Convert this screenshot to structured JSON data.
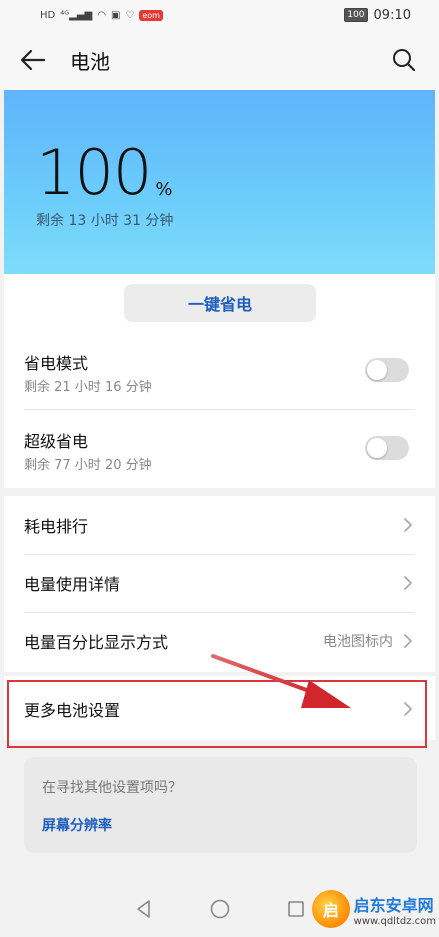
{
  "status_bar": {
    "left_icons": [
      "HD",
      "4G",
      "signal",
      "wifi",
      "app",
      "heart",
      "badge"
    ],
    "badge_text": "eom",
    "battery_text": "100",
    "time": "09:10"
  },
  "app_bar": {
    "title": "电池"
  },
  "hero": {
    "percent": "100",
    "unit": "%",
    "remaining": "剩余 13 小时 31 分钟"
  },
  "one_key": {
    "label": "一键省电"
  },
  "modes": [
    {
      "title": "省电模式",
      "sub": "剩余 21 小时 16 分钟",
      "on": false
    },
    {
      "title": "超级省电",
      "sub": "剩余 77 小时 20 分钟",
      "on": false
    }
  ],
  "nav_items": [
    {
      "label": "耗电排行",
      "value": ""
    },
    {
      "label": "电量使用详情",
      "value": ""
    },
    {
      "label": "电量百分比显示方式",
      "value": "电池图标内"
    }
  ],
  "more": {
    "label": "更多电池设置"
  },
  "tip": {
    "question": "在寻找其他设置项吗？",
    "link": "屏幕分辨率"
  },
  "watermark": {
    "logo": "启",
    "name": "启东安卓网",
    "url": "www.qdltdz.com"
  },
  "colors": {
    "accent": "#1f5fbf",
    "highlight": "#d9363e",
    "hero_top": "#5fb4fb",
    "hero_bottom": "#7fdcfa"
  }
}
